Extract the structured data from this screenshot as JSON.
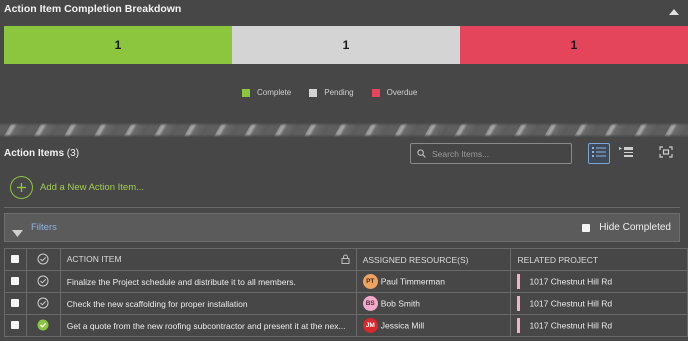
{
  "panel": {
    "title": "Action Item Completion Breakdown"
  },
  "breakdown": {
    "segments": [
      {
        "name": "Complete",
        "value": "1",
        "color": "#8cc63f"
      },
      {
        "name": "Pending",
        "value": "1",
        "color": "#d4d4d4"
      },
      {
        "name": "Overdue",
        "value": "1",
        "color": "#e4455a"
      }
    ]
  },
  "legend": {
    "complete": "Complete",
    "pending": "Pending",
    "overdue": "Overdue"
  },
  "action_items": {
    "title": "Action Items",
    "count": "(3)",
    "search_placeholder": "Search Items...",
    "add_label": "Add a New Action Item..."
  },
  "filters": {
    "label": "Filters",
    "hide_completed_label": "Hide Completed"
  },
  "table": {
    "headers": {
      "item": "ACTION ITEM",
      "resources": "ASSIGNED RESOURCE(S)",
      "project": "RELATED PROJECT"
    },
    "rows": [
      {
        "item": "Finalize the Project schedule and distribute it to all members.",
        "status": "pending",
        "initials": "PT",
        "resource": "Paul Timmerman",
        "avatar_color": "#f0a35e",
        "project": "1017 Chestnut Hill Rd"
      },
      {
        "item": "Check the new scaffolding for proper installation",
        "status": "pending",
        "initials": "BS",
        "resource": "Bob Smith",
        "avatar_color": "#f3a9c9",
        "project": "1017 Chestnut Hill Rd"
      },
      {
        "item": "Get a quote from the new roofing subcontractor and present it at the nex...",
        "status": "complete",
        "initials": "JM",
        "resource": "Jessica Mill",
        "avatar_color": "#d9272e",
        "project": "1017 Chestnut Hill Rd"
      }
    ]
  },
  "colors": {
    "accent_green": "#8cc63f",
    "link_blue": "#8fb3e0"
  }
}
